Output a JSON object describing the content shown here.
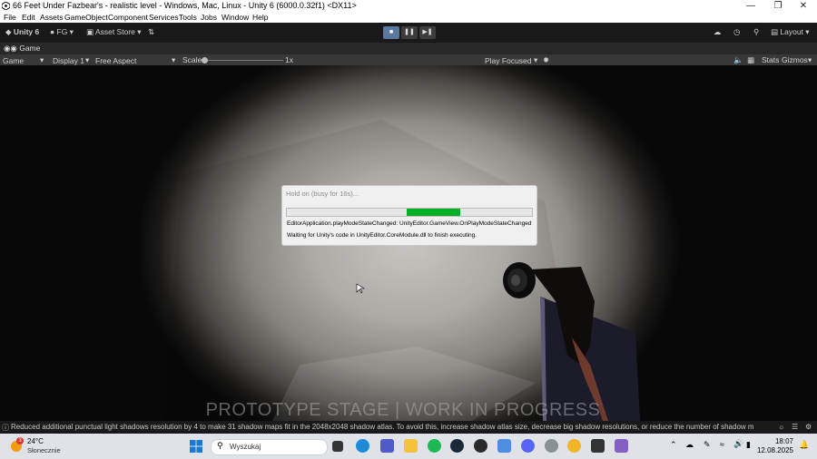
{
  "window": {
    "title": "66 Feet Under Fazbear's - realistic level - Windows, Mac, Linux - Unity 6 (6000.0.32f1) <DX11>"
  },
  "menu": [
    "File",
    "Edit",
    "Assets",
    "GameObject",
    "Component",
    "Services",
    "Tools",
    "Jobs",
    "Window",
    "Help"
  ],
  "toolbar": {
    "unity_label": "Unity 6",
    "account_label": "FG",
    "asset_store_label": "Asset Store",
    "layout_label": "Layout"
  },
  "tab": {
    "label": "Game"
  },
  "gamebar": {
    "view_label": "Game",
    "display_label": "Display 1",
    "aspect_label": "Free Aspect",
    "scale_label": "Scale",
    "scale_value": "1x",
    "play_focused_label": "Play Focused",
    "stats_label": "Stats",
    "gizmos_label": "Gizmos"
  },
  "watermark": "PROTOTYPE STAGE | WORK IN PROGRESS",
  "dialog": {
    "title": "Hold on (busy for 16s)...",
    "progress_start": 0.49,
    "progress_end": 0.71,
    "line1": "EditorApplication.playModeStateChanged: UnityEditor.GameView.OnPlayModeStateChanged",
    "line2": "Waiting for Unity's code in UnityEditor.CoreModule.dll to finish executing."
  },
  "status": {
    "message": "Reduced additional punctual light shadows resolution by 4 to make 31 shadow maps fit in the 2048x2048 shadow atlas. To avoid this, increase shadow atlas size, decrease big shadow resolutions, or reduce the number of shadow maps active in th"
  },
  "taskbar": {
    "weather_badge": "3",
    "temperature": "24°C",
    "weather_label": "Słonecznie",
    "search_placeholder": "Wyszukaj",
    "time": "18:07",
    "date": "12.08.2025"
  }
}
